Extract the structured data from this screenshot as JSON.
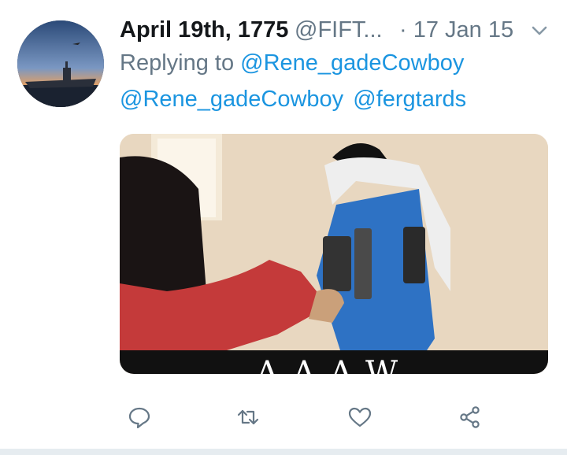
{
  "tweet": {
    "display_name": "April 19th, 1775",
    "handle": "@FIFT...",
    "date": "· 17 Jan 15",
    "replying_prefix": "Replying to",
    "replying_to": "@Rene_gadeCowboy",
    "body_mentions": [
      "@Rene_gadeCowboy",
      "@fergtards"
    ],
    "media_caption": "AAAW"
  },
  "actions": {
    "reply_icon": "reply-icon",
    "retweet_icon": "retweet-icon",
    "like_icon": "heart-icon",
    "share_icon": "share-icon"
  },
  "colors": {
    "name": "#14171a",
    "secondary": "#657786",
    "link": "#1b95e0",
    "divider": "#e6ecf0"
  }
}
